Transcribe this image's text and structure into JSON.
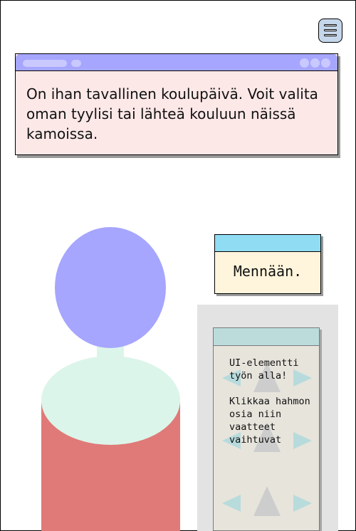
{
  "dialog": {
    "text": "On ihan tavallinen koulupäivä. Voit valita oman tyylisi tai lähteä kouluun näissä kamoissa."
  },
  "choice": {
    "label": "Mennään."
  },
  "info_panel": {
    "line1": "UI-elementti työn alla!",
    "line2": "Klikkaa hahmon osia niin vaatteet vaihtuvat"
  },
  "icons": {
    "menu": "hamburger-menu-icon",
    "arrows": "left-right-arrow-icons",
    "up": "up-triangle-icon"
  },
  "colors": {
    "dialog_bar": "#a6a6ff",
    "dialog_bg": "#fde8e8",
    "choice_bar": "#8fdcf3",
    "choice_bg": "#fff5dc",
    "head": "#a6a6ff",
    "torso": "#dcf5ea",
    "pants": "#e07a78"
  }
}
